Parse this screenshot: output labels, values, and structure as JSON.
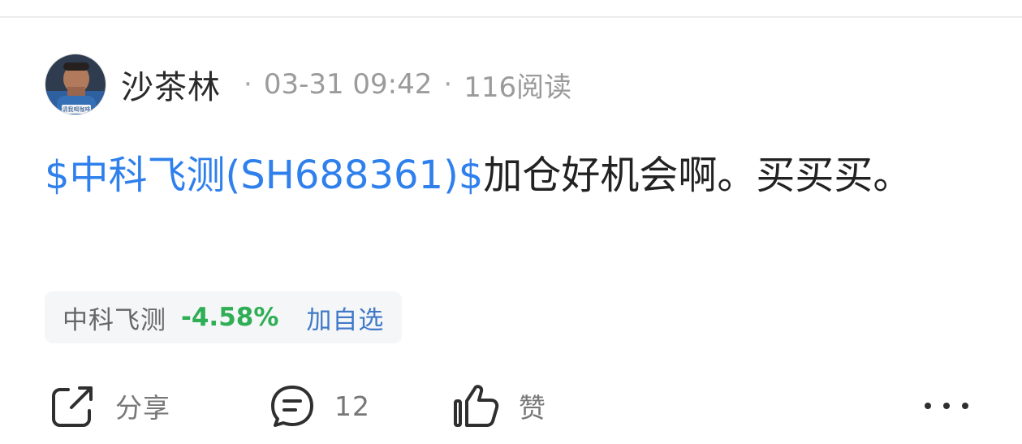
{
  "post": {
    "author": "沙茶林",
    "date_time": "03-31 09:42",
    "reads": "116阅读",
    "separator": "·",
    "content_stock": "$中科飞测(SH688361)$",
    "content_text": "加仓好机会啊。买买买。"
  },
  "stock_chip": {
    "name": "中科飞测",
    "change": "-4.58%",
    "add_label": "加自选"
  },
  "actions": {
    "share_label": "分享",
    "comment_count": "12",
    "like_label": "赞"
  },
  "colors": {
    "link": "#2f80ed",
    "drop": "#2fae55",
    "accent": "#3f79c8"
  },
  "icons": {
    "share": "share-icon",
    "comment": "comment-icon",
    "like": "thumbs-up-icon",
    "more": "more-icon"
  },
  "avatar": {
    "caption": "请我喝咖啡"
  }
}
